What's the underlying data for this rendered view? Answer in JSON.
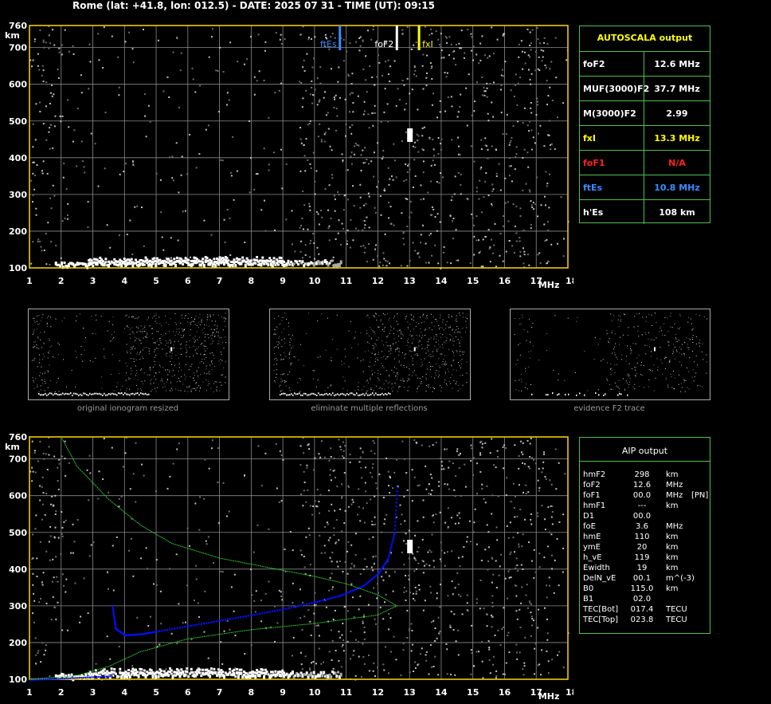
{
  "header": {
    "title": "Rome (lat: +41.8, lon: 012.5) - DATE: 2025 07 31 - TIME (UT): 09:15"
  },
  "autoscala": {
    "title": "AUTOSCALA output",
    "rows": [
      {
        "label": "foF2",
        "value": "12.6 MHz",
        "color": "#ffffff"
      },
      {
        "label": "MUF(3000)F2",
        "value": "37.7 MHz",
        "color": "#ffffff"
      },
      {
        "label": "M(3000)F2",
        "value": "2.99",
        "color": "#ffffff"
      },
      {
        "label": "fxI",
        "value": "13.3 MHz",
        "color": "#ffff00"
      },
      {
        "label": "foF1",
        "value": "N/A",
        "color": "#ff2020"
      },
      {
        "label": "ftEs",
        "value": "10.8 MHz",
        "color": "#3a8cff"
      },
      {
        "label": "h'Es",
        "value": "108    km",
        "color": "#ffffff"
      }
    ]
  },
  "aip": {
    "title": "AIP output",
    "rows": [
      {
        "name": "hmF2",
        "value": "298",
        "unit": "km",
        "extra": ""
      },
      {
        "name": "foF2",
        "value": "12.6",
        "unit": "MHz",
        "extra": ""
      },
      {
        "name": "foF1",
        "value": "00.0",
        "unit": "MHz",
        "extra": "[PN]"
      },
      {
        "name": "hmF1",
        "value": "---",
        "unit": "km",
        "extra": ""
      },
      {
        "name": "D1",
        "value": "00.0",
        "unit": "",
        "extra": ""
      },
      {
        "name": "foE",
        "value": "3.6",
        "unit": "MHz",
        "extra": ""
      },
      {
        "name": "hmE",
        "value": "110",
        "unit": "km",
        "extra": ""
      },
      {
        "name": "ymE",
        "value": "20",
        "unit": "km",
        "extra": ""
      },
      {
        "name": "h_vE",
        "value": "119",
        "unit": "km",
        "extra": ""
      },
      {
        "name": "Ewidth",
        "value": "19",
        "unit": "km",
        "extra": ""
      },
      {
        "name": "DelN_vE",
        "value": "00.1",
        "unit": "m^(-3)",
        "extra": ""
      },
      {
        "name": "B0",
        "value": "115.0",
        "unit": "km",
        "extra": ""
      },
      {
        "name": "B1",
        "value": "02.0",
        "unit": "",
        "extra": ""
      },
      {
        "name": "TEC[Bot]",
        "value": "017.4",
        "unit": "TECU",
        "extra": ""
      },
      {
        "name": "TEC[Top]",
        "value": "023.8",
        "unit": "TECU",
        "extra": ""
      }
    ]
  },
  "thumbnails": [
    {
      "caption": "original ionogram resized"
    },
    {
      "caption": "eliminate multiple reflections"
    },
    {
      "caption": "evidence F2 trace"
    }
  ],
  "colors": {
    "grid": "#8a8a8a",
    "frame": "#ffd700",
    "panel_border": "#4fbf4f",
    "es_marker": "#3a8cff",
    "fof2_marker": "#ffffff",
    "fxi_marker": "#ffff00",
    "profile": "#0010ff",
    "model_curve": "#30e030"
  },
  "chart_data": [
    {
      "type": "scatter",
      "title": "",
      "xlabel": "MHz",
      "ylabel": "km",
      "xlim": [
        1,
        18
      ],
      "ylim": [
        100,
        760
      ],
      "x_ticks": [
        "1",
        "2",
        "3",
        "4",
        "5",
        "6",
        "7",
        "8",
        "9",
        "10",
        "11",
        "12",
        "13",
        "14",
        "15",
        "16",
        "17",
        "18"
      ],
      "y_ticks": [
        "100",
        "200",
        "300",
        "400",
        "500",
        "600",
        "700",
        "760"
      ],
      "markers": [
        {
          "label": "ftEs",
          "x": 10.8
        },
        {
          "label": "foF2",
          "x": 12.6
        },
        {
          "label": "fxI",
          "x": 13.3
        }
      ],
      "es_trace": {
        "f_start": 1.8,
        "f_end": 10.8,
        "height": 110
      },
      "f2_echo": {
        "f": 13.0,
        "h": 460
      }
    },
    {
      "type": "line",
      "title": "",
      "xlabel": "MHz",
      "ylabel": "km",
      "xlim": [
        1,
        18
      ],
      "ylim": [
        100,
        760
      ],
      "x_ticks": [
        "1",
        "2",
        "3",
        "4",
        "5",
        "6",
        "7",
        "8",
        "9",
        "10",
        "11",
        "12",
        "13",
        "14",
        "15",
        "16",
        "17",
        "18"
      ],
      "y_ticks": [
        "100",
        "200",
        "300",
        "400",
        "500",
        "600",
        "700",
        "760"
      ],
      "series": [
        {
          "values": [
            [
              3.6,
              300
            ],
            [
              3.7,
              240
            ],
            [
              4.0,
              222
            ],
            [
              4.5,
              225
            ],
            [
              5.0,
              232
            ],
            [
              6.0,
              247
            ],
            [
              7.0,
              262
            ],
            [
              8.0,
              277
            ],
            [
              9.0,
              293
            ],
            [
              10.0,
              312
            ],
            [
              10.8,
              330
            ],
            [
              11.5,
              355
            ],
            [
              12.0,
              390
            ],
            [
              12.3,
              430
            ],
            [
              12.5,
              500
            ],
            [
              12.6,
              630
            ]
          ]
        },
        {
          "values": [
            [
              2.0,
              760
            ],
            [
              2.5,
              680
            ],
            [
              3.5,
              590
            ],
            [
              4.5,
              520
            ],
            [
              5.5,
              470
            ],
            [
              7.0,
              430
            ],
            [
              8.5,
              405
            ],
            [
              10.0,
              380
            ],
            [
              11.0,
              360
            ],
            [
              12.0,
              330
            ],
            [
              12.6,
              300
            ],
            [
              12.0,
              275
            ],
            [
              10.0,
              252
            ],
            [
              8.0,
              235
            ],
            [
              6.0,
              210
            ],
            [
              4.5,
              175
            ],
            [
              3.5,
              135
            ],
            [
              2.5,
              110
            ],
            [
              1.0,
              100
            ]
          ]
        }
      ],
      "f2_echo": {
        "f": 13.0,
        "h": 460
      },
      "es_trace": {
        "f_start": 1.8,
        "f_end": 10.8,
        "height": 110
      }
    }
  ]
}
